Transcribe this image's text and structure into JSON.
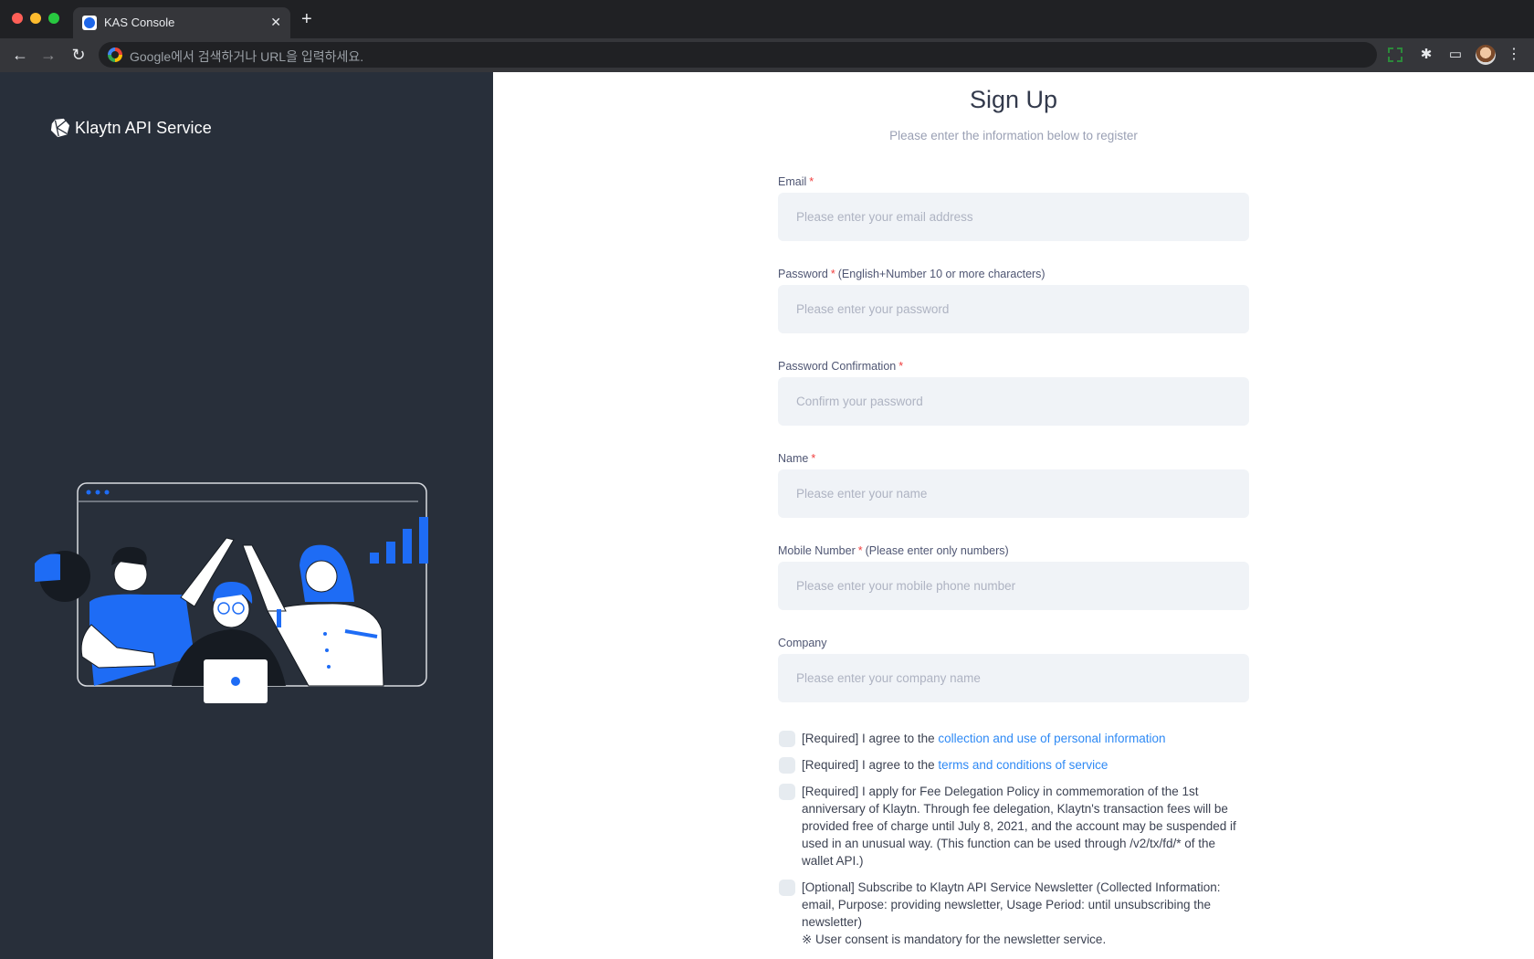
{
  "browser": {
    "tab_title": "KAS Console",
    "tab_close_glyph": "✕",
    "new_tab_glyph": "+",
    "omnibox_placeholder": "Google에서 검색하거나 URL을 입력하세요.",
    "icons": {
      "back": "←",
      "forward": "→",
      "reload": "↻",
      "extensions": "✱",
      "cast": "▭",
      "menu": "⋮"
    }
  },
  "brand": {
    "name": "Klaytn API Service",
    "accent": "#1e66e8"
  },
  "form": {
    "title": "Sign Up",
    "subtitle": "Please enter the information below to register",
    "required_mark": "*",
    "fields": [
      {
        "label": "Email",
        "required": true,
        "hint": "",
        "placeholder": "Please enter your email address",
        "value": ""
      },
      {
        "label": "Password",
        "required": true,
        "hint": "(English+Number 10 or more characters)",
        "placeholder": "Please enter your password",
        "value": ""
      },
      {
        "label": "Password Confirmation",
        "required": true,
        "hint": "",
        "placeholder": "Confirm your password",
        "value": ""
      },
      {
        "label": "Name",
        "required": true,
        "hint": "",
        "placeholder": "Please enter your name",
        "value": ""
      },
      {
        "label": "Mobile Number",
        "required": true,
        "hint": "(Please enter only numbers)",
        "placeholder": "Please enter your mobile phone number",
        "value": ""
      },
      {
        "label": "Company",
        "required": false,
        "hint": "",
        "placeholder": "Please enter your company name",
        "value": ""
      }
    ],
    "agreements": [
      {
        "prefix": "[Required] I agree to the ",
        "link": "collection and use of personal information",
        "suffix": "",
        "checked": false
      },
      {
        "prefix": "[Required] I agree to the ",
        "link": "terms and conditions of service",
        "suffix": "",
        "checked": false
      },
      {
        "prefix": "[Required] I apply for Fee Delegation Policy in commemoration of the 1st anniversary of Klaytn. Through fee delegation, Klaytn's transaction fees will be provided free of charge until July 8, 2021, and the account may be suspended if used in an unusual way. (This function can be used through /v2/tx/fd/* of the wallet API.)",
        "link": "",
        "suffix": "",
        "checked": false
      },
      {
        "prefix": "[Optional] Subscribe to Klaytn API Service Newsletter (Collected Information: email, Purpose: providing newsletter, Usage Period: until unsubscribing the newsletter)",
        "link": "",
        "suffix": "",
        "note": "※ User consent is mandatory for the newsletter service.",
        "checked": false
      }
    ]
  }
}
